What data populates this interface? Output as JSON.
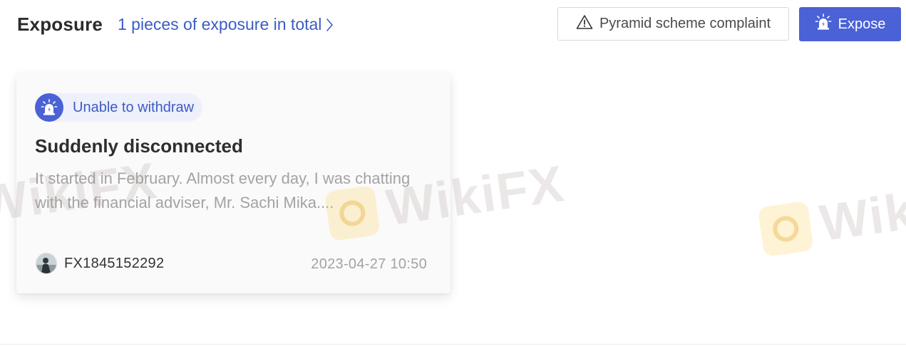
{
  "header": {
    "title": "Exposure",
    "total_link": "1 pieces of exposure in total",
    "complaint_button": "Pyramid scheme complaint",
    "expose_button": "Expose"
  },
  "watermark": {
    "text": "WikiFX"
  },
  "exposures": [
    {
      "tag": "Unable to withdraw",
      "title": "Suddenly disconnected",
      "excerpt": "It started in February. Almost every day, I was chatting with the financial adviser, Mr. Sachi Mika....",
      "author": "FX1845152292",
      "timestamp": "2023-04-27 10:50"
    }
  ],
  "colors": {
    "accent": "#4a62d6",
    "link": "#3c5cc6",
    "title_text": "#2b2b2b",
    "muted_text": "#a3a3a3"
  },
  "icons": {
    "complaint": "warning-triangle-icon",
    "expose": "siren-icon",
    "tag": "siren-icon",
    "link": "chevron-right-icon"
  }
}
